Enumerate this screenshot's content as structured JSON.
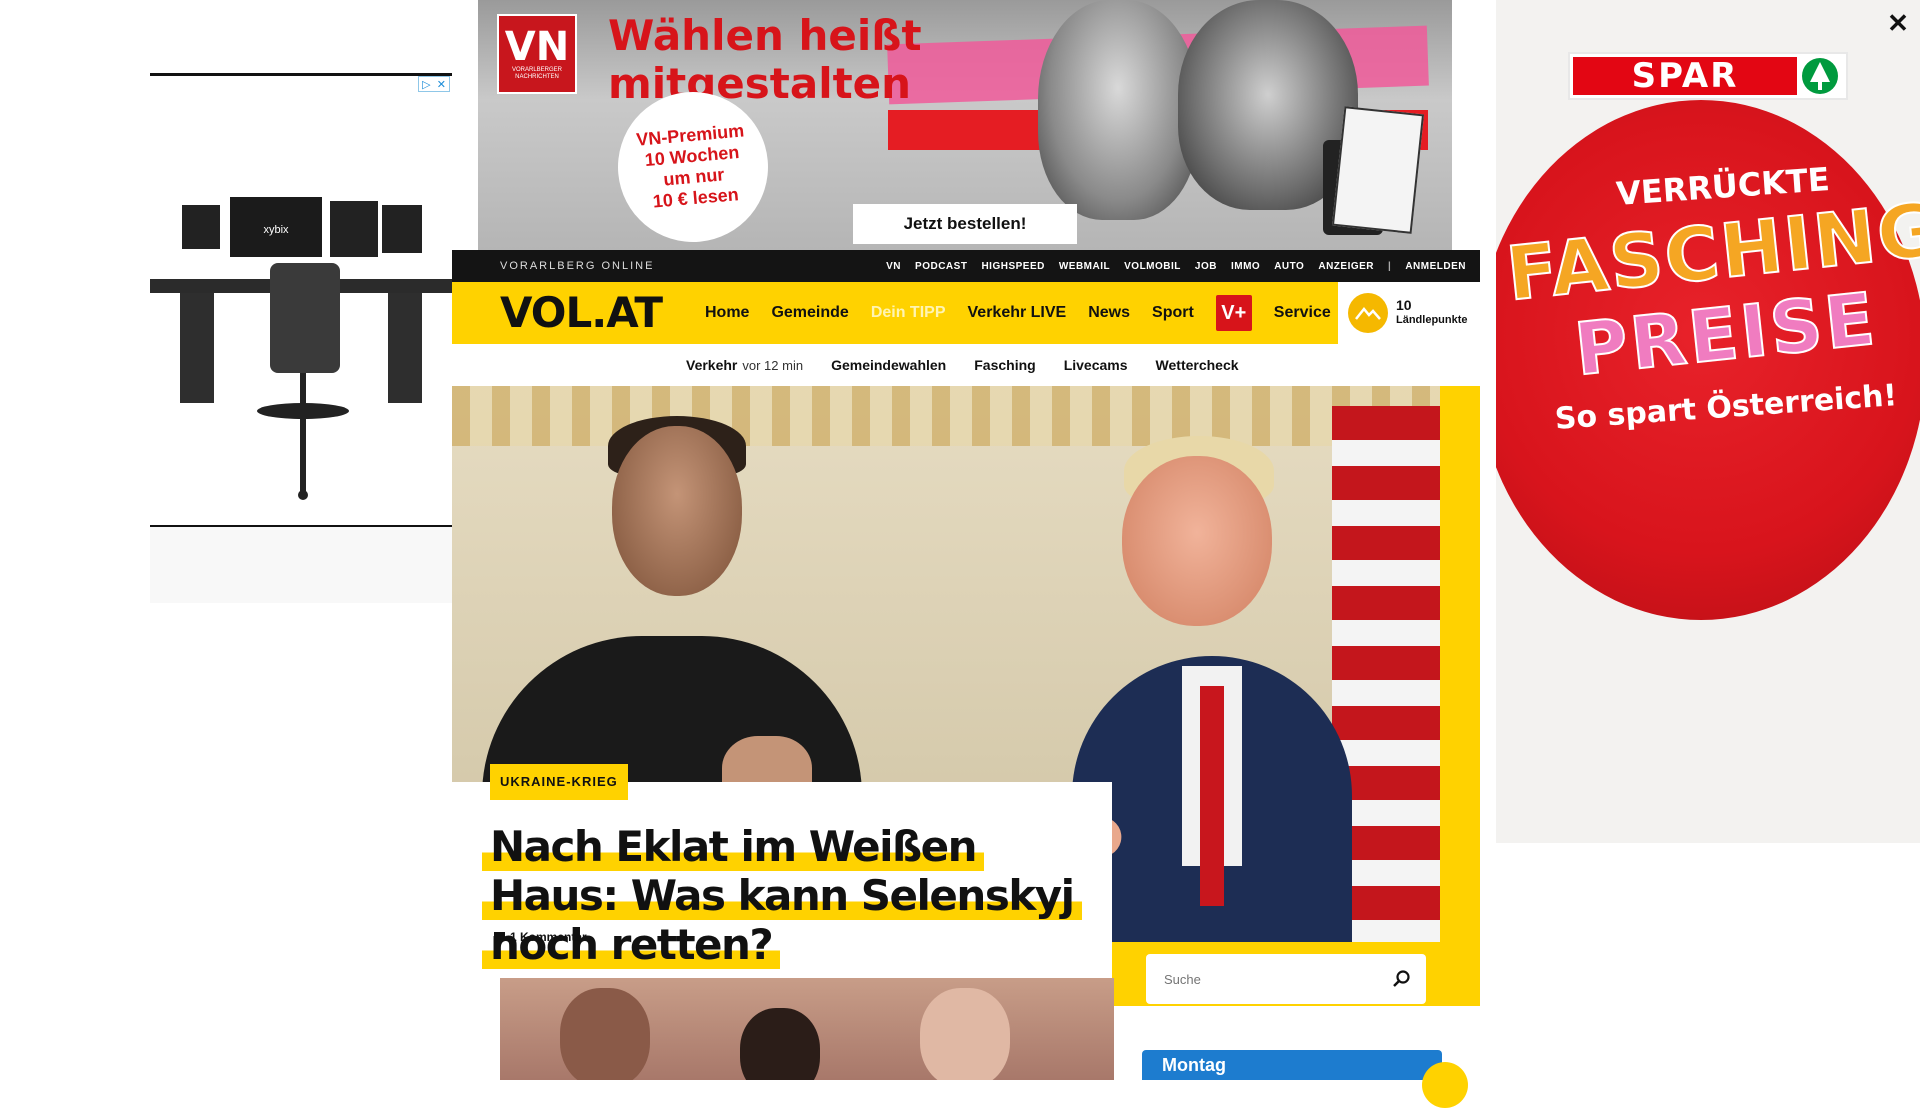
{
  "top_ad": {
    "brand_big": "VN",
    "brand_small": "VORARLBERGER NACHRICHTEN",
    "headline_line1": "Wählen heißt",
    "headline_line2": "mitgestalten",
    "promo_line1": "VN-Premium",
    "promo_line2": "10 Wochen",
    "promo_line3": "um nur",
    "promo_line4": "10 € lesen",
    "cta": "Jetzt bestellen!"
  },
  "left_ad": {
    "brand": "xybix"
  },
  "right_ad": {
    "brand": "SPAR",
    "line1": "VERRÜCKTE",
    "line2": "FASCHINGS",
    "line3": "PREISE",
    "line4": "So spart Österreich!",
    "close": "✕"
  },
  "topbar": {
    "brand": "VORARLBERG ONLINE",
    "links": [
      "VN",
      "PODCAST",
      "HIGHSPEED",
      "WEBMAIL",
      "VOLMOBIL",
      "JOB",
      "IMMO",
      "AUTO",
      "ANZEIGER"
    ],
    "separator": "|",
    "login": "ANMELDEN"
  },
  "header": {
    "logo": "VOL.AT",
    "nav": [
      "Home",
      "Gemeinde",
      "Dein TIPP",
      "Verkehr LIVE",
      "News",
      "Sport"
    ],
    "vplus": "V+",
    "service": "Service",
    "points_value": "10",
    "points_label": "Ländlepunkte"
  },
  "subnav": {
    "traffic_label": "Verkehr",
    "traffic_time": "vor 12 min",
    "items": [
      "Gemeindewahlen",
      "Fasching",
      "Livecams",
      "Wettercheck"
    ]
  },
  "hero": {
    "tag": "UKRAINE-KRIEG",
    "title": "Nach Eklat im Weißen Haus: Was kann Selenskyj noch retten?",
    "comments": "1 Kommentar"
  },
  "search": {
    "placeholder": "Suche"
  },
  "weather": {
    "day": "Montag"
  },
  "colors": {
    "accent_yellow": "#ffd200",
    "brand_red": "#d7141a",
    "topbar_black": "#141414",
    "spar_red": "#e30613"
  }
}
